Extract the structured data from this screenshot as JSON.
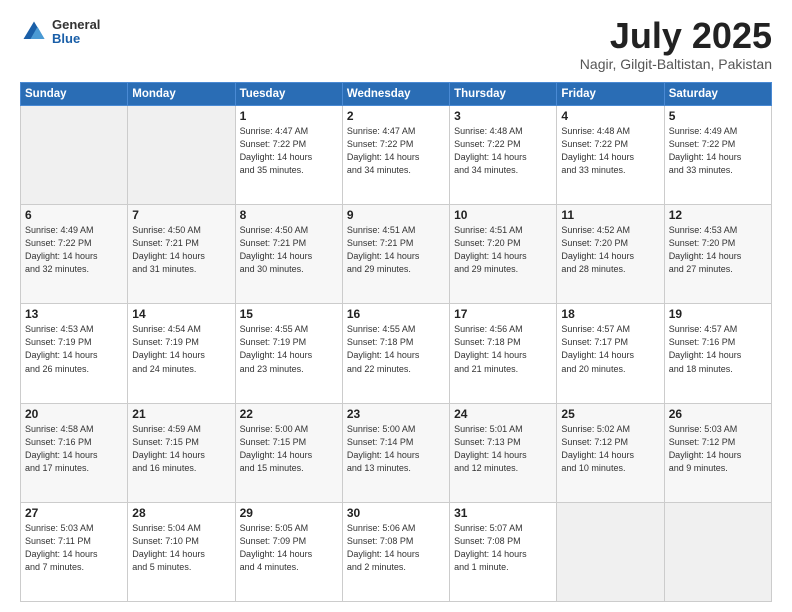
{
  "header": {
    "logo_general": "General",
    "logo_blue": "Blue",
    "title": "July 2025",
    "location": "Nagir, Gilgit-Baltistan, Pakistan"
  },
  "weekdays": [
    "Sunday",
    "Monday",
    "Tuesday",
    "Wednesday",
    "Thursday",
    "Friday",
    "Saturday"
  ],
  "weeks": [
    [
      {
        "day": "",
        "info": ""
      },
      {
        "day": "",
        "info": ""
      },
      {
        "day": "1",
        "info": "Sunrise: 4:47 AM\nSunset: 7:22 PM\nDaylight: 14 hours\nand 35 minutes."
      },
      {
        "day": "2",
        "info": "Sunrise: 4:47 AM\nSunset: 7:22 PM\nDaylight: 14 hours\nand 34 minutes."
      },
      {
        "day": "3",
        "info": "Sunrise: 4:48 AM\nSunset: 7:22 PM\nDaylight: 14 hours\nand 34 minutes."
      },
      {
        "day": "4",
        "info": "Sunrise: 4:48 AM\nSunset: 7:22 PM\nDaylight: 14 hours\nand 33 minutes."
      },
      {
        "day": "5",
        "info": "Sunrise: 4:49 AM\nSunset: 7:22 PM\nDaylight: 14 hours\nand 33 minutes."
      }
    ],
    [
      {
        "day": "6",
        "info": "Sunrise: 4:49 AM\nSunset: 7:22 PM\nDaylight: 14 hours\nand 32 minutes."
      },
      {
        "day": "7",
        "info": "Sunrise: 4:50 AM\nSunset: 7:21 PM\nDaylight: 14 hours\nand 31 minutes."
      },
      {
        "day": "8",
        "info": "Sunrise: 4:50 AM\nSunset: 7:21 PM\nDaylight: 14 hours\nand 30 minutes."
      },
      {
        "day": "9",
        "info": "Sunrise: 4:51 AM\nSunset: 7:21 PM\nDaylight: 14 hours\nand 29 minutes."
      },
      {
        "day": "10",
        "info": "Sunrise: 4:51 AM\nSunset: 7:20 PM\nDaylight: 14 hours\nand 29 minutes."
      },
      {
        "day": "11",
        "info": "Sunrise: 4:52 AM\nSunset: 7:20 PM\nDaylight: 14 hours\nand 28 minutes."
      },
      {
        "day": "12",
        "info": "Sunrise: 4:53 AM\nSunset: 7:20 PM\nDaylight: 14 hours\nand 27 minutes."
      }
    ],
    [
      {
        "day": "13",
        "info": "Sunrise: 4:53 AM\nSunset: 7:19 PM\nDaylight: 14 hours\nand 26 minutes."
      },
      {
        "day": "14",
        "info": "Sunrise: 4:54 AM\nSunset: 7:19 PM\nDaylight: 14 hours\nand 24 minutes."
      },
      {
        "day": "15",
        "info": "Sunrise: 4:55 AM\nSunset: 7:19 PM\nDaylight: 14 hours\nand 23 minutes."
      },
      {
        "day": "16",
        "info": "Sunrise: 4:55 AM\nSunset: 7:18 PM\nDaylight: 14 hours\nand 22 minutes."
      },
      {
        "day": "17",
        "info": "Sunrise: 4:56 AM\nSunset: 7:18 PM\nDaylight: 14 hours\nand 21 minutes."
      },
      {
        "day": "18",
        "info": "Sunrise: 4:57 AM\nSunset: 7:17 PM\nDaylight: 14 hours\nand 20 minutes."
      },
      {
        "day": "19",
        "info": "Sunrise: 4:57 AM\nSunset: 7:16 PM\nDaylight: 14 hours\nand 18 minutes."
      }
    ],
    [
      {
        "day": "20",
        "info": "Sunrise: 4:58 AM\nSunset: 7:16 PM\nDaylight: 14 hours\nand 17 minutes."
      },
      {
        "day": "21",
        "info": "Sunrise: 4:59 AM\nSunset: 7:15 PM\nDaylight: 14 hours\nand 16 minutes."
      },
      {
        "day": "22",
        "info": "Sunrise: 5:00 AM\nSunset: 7:15 PM\nDaylight: 14 hours\nand 15 minutes."
      },
      {
        "day": "23",
        "info": "Sunrise: 5:00 AM\nSunset: 7:14 PM\nDaylight: 14 hours\nand 13 minutes."
      },
      {
        "day": "24",
        "info": "Sunrise: 5:01 AM\nSunset: 7:13 PM\nDaylight: 14 hours\nand 12 minutes."
      },
      {
        "day": "25",
        "info": "Sunrise: 5:02 AM\nSunset: 7:12 PM\nDaylight: 14 hours\nand 10 minutes."
      },
      {
        "day": "26",
        "info": "Sunrise: 5:03 AM\nSunset: 7:12 PM\nDaylight: 14 hours\nand 9 minutes."
      }
    ],
    [
      {
        "day": "27",
        "info": "Sunrise: 5:03 AM\nSunset: 7:11 PM\nDaylight: 14 hours\nand 7 minutes."
      },
      {
        "day": "28",
        "info": "Sunrise: 5:04 AM\nSunset: 7:10 PM\nDaylight: 14 hours\nand 5 minutes."
      },
      {
        "day": "29",
        "info": "Sunrise: 5:05 AM\nSunset: 7:09 PM\nDaylight: 14 hours\nand 4 minutes."
      },
      {
        "day": "30",
        "info": "Sunrise: 5:06 AM\nSunset: 7:08 PM\nDaylight: 14 hours\nand 2 minutes."
      },
      {
        "day": "31",
        "info": "Sunrise: 5:07 AM\nSunset: 7:08 PM\nDaylight: 14 hours\nand 1 minute."
      },
      {
        "day": "",
        "info": ""
      },
      {
        "day": "",
        "info": ""
      }
    ]
  ]
}
